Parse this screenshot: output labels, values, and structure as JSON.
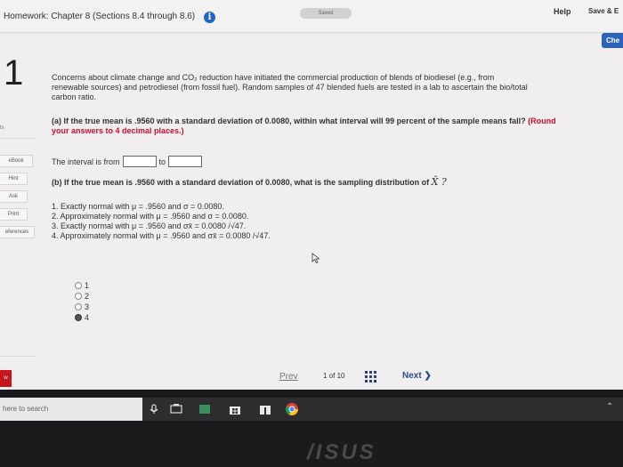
{
  "header": {
    "title": "Homework: Chapter 8 (Sections 8.4 through 8.6)",
    "saved_label": "Saved",
    "help_label": "Help",
    "save_exit_label": "Save & E",
    "check_label": "Che"
  },
  "sidebar": {
    "question_number": "1",
    "points_label": "ts",
    "ebook": "eBook",
    "hint": "Hint",
    "ask": "Ask",
    "print": "Print",
    "references": "eferences",
    "red_tag": "w"
  },
  "question": {
    "intro_line1": "Concerns about climate change and CO₂ reduction have initiated the commercial production of blends of biodiesel (e.g., from",
    "intro_line2": "renewable sources) and petrodiesel (from fossil fuel). Random samples of 47 blended fuels are tested in a lab to ascertain the bio/total",
    "intro_line3": "carbon ratio.",
    "part_a_text": "(a) If the true mean is .9560 with a standard deviation of 0.0080, within what interval will 99 percent of the sample means fall?",
    "part_a_instruction_1": "(Round",
    "part_a_instruction_2": "your answers to 4 decimal places.)",
    "interval_prefix": "The interval is from",
    "interval_to": "to",
    "from_value": "",
    "to_value": "",
    "part_b_text": "(b) If the true mean is .9560 with a standard deviation of 0.0080, what is the sampling distribution of",
    "part_b_var": "X̄ ?",
    "choices": [
      "1. Exactly normal with μ = .9560 and σ = 0.0080.",
      "2. Approximately normal with μ = .9560 and σ = 0.0080.",
      "3. Exactly normal with μ = .9560 and σx̄ = 0.0080 /√47.",
      "4. Approximately normal with μ = .9560 and σx̄ = 0.0080 /√47."
    ],
    "radio_options": [
      "1",
      "2",
      "3",
      "4"
    ],
    "selected_option": "4"
  },
  "pager": {
    "prev": "Prev",
    "page_of": "1 of 10",
    "next": "Next"
  },
  "taskbar": {
    "search_placeholder": "here to search"
  },
  "bezel": {
    "brand": "/ISUS"
  }
}
